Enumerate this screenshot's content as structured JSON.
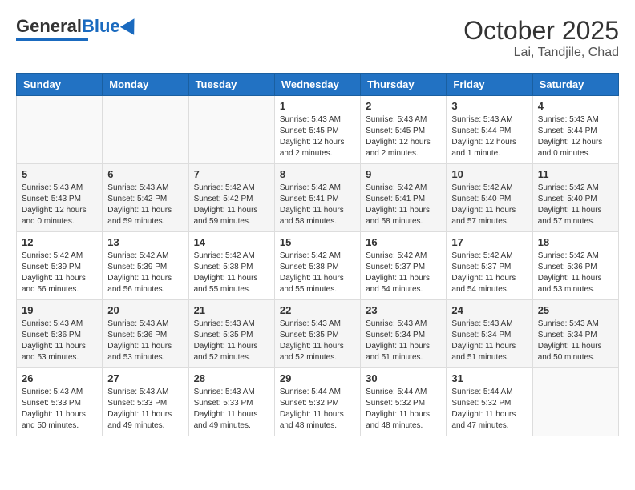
{
  "header": {
    "logo_general": "General",
    "logo_blue": "Blue",
    "month_title": "October 2025",
    "location": "Lai, Tandjile, Chad"
  },
  "days_of_week": [
    "Sunday",
    "Monday",
    "Tuesday",
    "Wednesday",
    "Thursday",
    "Friday",
    "Saturday"
  ],
  "weeks": [
    [
      {
        "day": "",
        "info": ""
      },
      {
        "day": "",
        "info": ""
      },
      {
        "day": "",
        "info": ""
      },
      {
        "day": "1",
        "info": "Sunrise: 5:43 AM\nSunset: 5:45 PM\nDaylight: 12 hours and 2 minutes."
      },
      {
        "day": "2",
        "info": "Sunrise: 5:43 AM\nSunset: 5:45 PM\nDaylight: 12 hours and 2 minutes."
      },
      {
        "day": "3",
        "info": "Sunrise: 5:43 AM\nSunset: 5:44 PM\nDaylight: 12 hours and 1 minute."
      },
      {
        "day": "4",
        "info": "Sunrise: 5:43 AM\nSunset: 5:44 PM\nDaylight: 12 hours and 0 minutes."
      }
    ],
    [
      {
        "day": "5",
        "info": "Sunrise: 5:43 AM\nSunset: 5:43 PM\nDaylight: 12 hours and 0 minutes."
      },
      {
        "day": "6",
        "info": "Sunrise: 5:43 AM\nSunset: 5:42 PM\nDaylight: 11 hours and 59 minutes."
      },
      {
        "day": "7",
        "info": "Sunrise: 5:42 AM\nSunset: 5:42 PM\nDaylight: 11 hours and 59 minutes."
      },
      {
        "day": "8",
        "info": "Sunrise: 5:42 AM\nSunset: 5:41 PM\nDaylight: 11 hours and 58 minutes."
      },
      {
        "day": "9",
        "info": "Sunrise: 5:42 AM\nSunset: 5:41 PM\nDaylight: 11 hours and 58 minutes."
      },
      {
        "day": "10",
        "info": "Sunrise: 5:42 AM\nSunset: 5:40 PM\nDaylight: 11 hours and 57 minutes."
      },
      {
        "day": "11",
        "info": "Sunrise: 5:42 AM\nSunset: 5:40 PM\nDaylight: 11 hours and 57 minutes."
      }
    ],
    [
      {
        "day": "12",
        "info": "Sunrise: 5:42 AM\nSunset: 5:39 PM\nDaylight: 11 hours and 56 minutes."
      },
      {
        "day": "13",
        "info": "Sunrise: 5:42 AM\nSunset: 5:39 PM\nDaylight: 11 hours and 56 minutes."
      },
      {
        "day": "14",
        "info": "Sunrise: 5:42 AM\nSunset: 5:38 PM\nDaylight: 11 hours and 55 minutes."
      },
      {
        "day": "15",
        "info": "Sunrise: 5:42 AM\nSunset: 5:38 PM\nDaylight: 11 hours and 55 minutes."
      },
      {
        "day": "16",
        "info": "Sunrise: 5:42 AM\nSunset: 5:37 PM\nDaylight: 11 hours and 54 minutes."
      },
      {
        "day": "17",
        "info": "Sunrise: 5:42 AM\nSunset: 5:37 PM\nDaylight: 11 hours and 54 minutes."
      },
      {
        "day": "18",
        "info": "Sunrise: 5:42 AM\nSunset: 5:36 PM\nDaylight: 11 hours and 53 minutes."
      }
    ],
    [
      {
        "day": "19",
        "info": "Sunrise: 5:43 AM\nSunset: 5:36 PM\nDaylight: 11 hours and 53 minutes."
      },
      {
        "day": "20",
        "info": "Sunrise: 5:43 AM\nSunset: 5:36 PM\nDaylight: 11 hours and 53 minutes."
      },
      {
        "day": "21",
        "info": "Sunrise: 5:43 AM\nSunset: 5:35 PM\nDaylight: 11 hours and 52 minutes."
      },
      {
        "day": "22",
        "info": "Sunrise: 5:43 AM\nSunset: 5:35 PM\nDaylight: 11 hours and 52 minutes."
      },
      {
        "day": "23",
        "info": "Sunrise: 5:43 AM\nSunset: 5:34 PM\nDaylight: 11 hours and 51 minutes."
      },
      {
        "day": "24",
        "info": "Sunrise: 5:43 AM\nSunset: 5:34 PM\nDaylight: 11 hours and 51 minutes."
      },
      {
        "day": "25",
        "info": "Sunrise: 5:43 AM\nSunset: 5:34 PM\nDaylight: 11 hours and 50 minutes."
      }
    ],
    [
      {
        "day": "26",
        "info": "Sunrise: 5:43 AM\nSunset: 5:33 PM\nDaylight: 11 hours and 50 minutes."
      },
      {
        "day": "27",
        "info": "Sunrise: 5:43 AM\nSunset: 5:33 PM\nDaylight: 11 hours and 49 minutes."
      },
      {
        "day": "28",
        "info": "Sunrise: 5:43 AM\nSunset: 5:33 PM\nDaylight: 11 hours and 49 minutes."
      },
      {
        "day": "29",
        "info": "Sunrise: 5:44 AM\nSunset: 5:32 PM\nDaylight: 11 hours and 48 minutes."
      },
      {
        "day": "30",
        "info": "Sunrise: 5:44 AM\nSunset: 5:32 PM\nDaylight: 11 hours and 48 minutes."
      },
      {
        "day": "31",
        "info": "Sunrise: 5:44 AM\nSunset: 5:32 PM\nDaylight: 11 hours and 47 minutes."
      },
      {
        "day": "",
        "info": ""
      }
    ]
  ]
}
